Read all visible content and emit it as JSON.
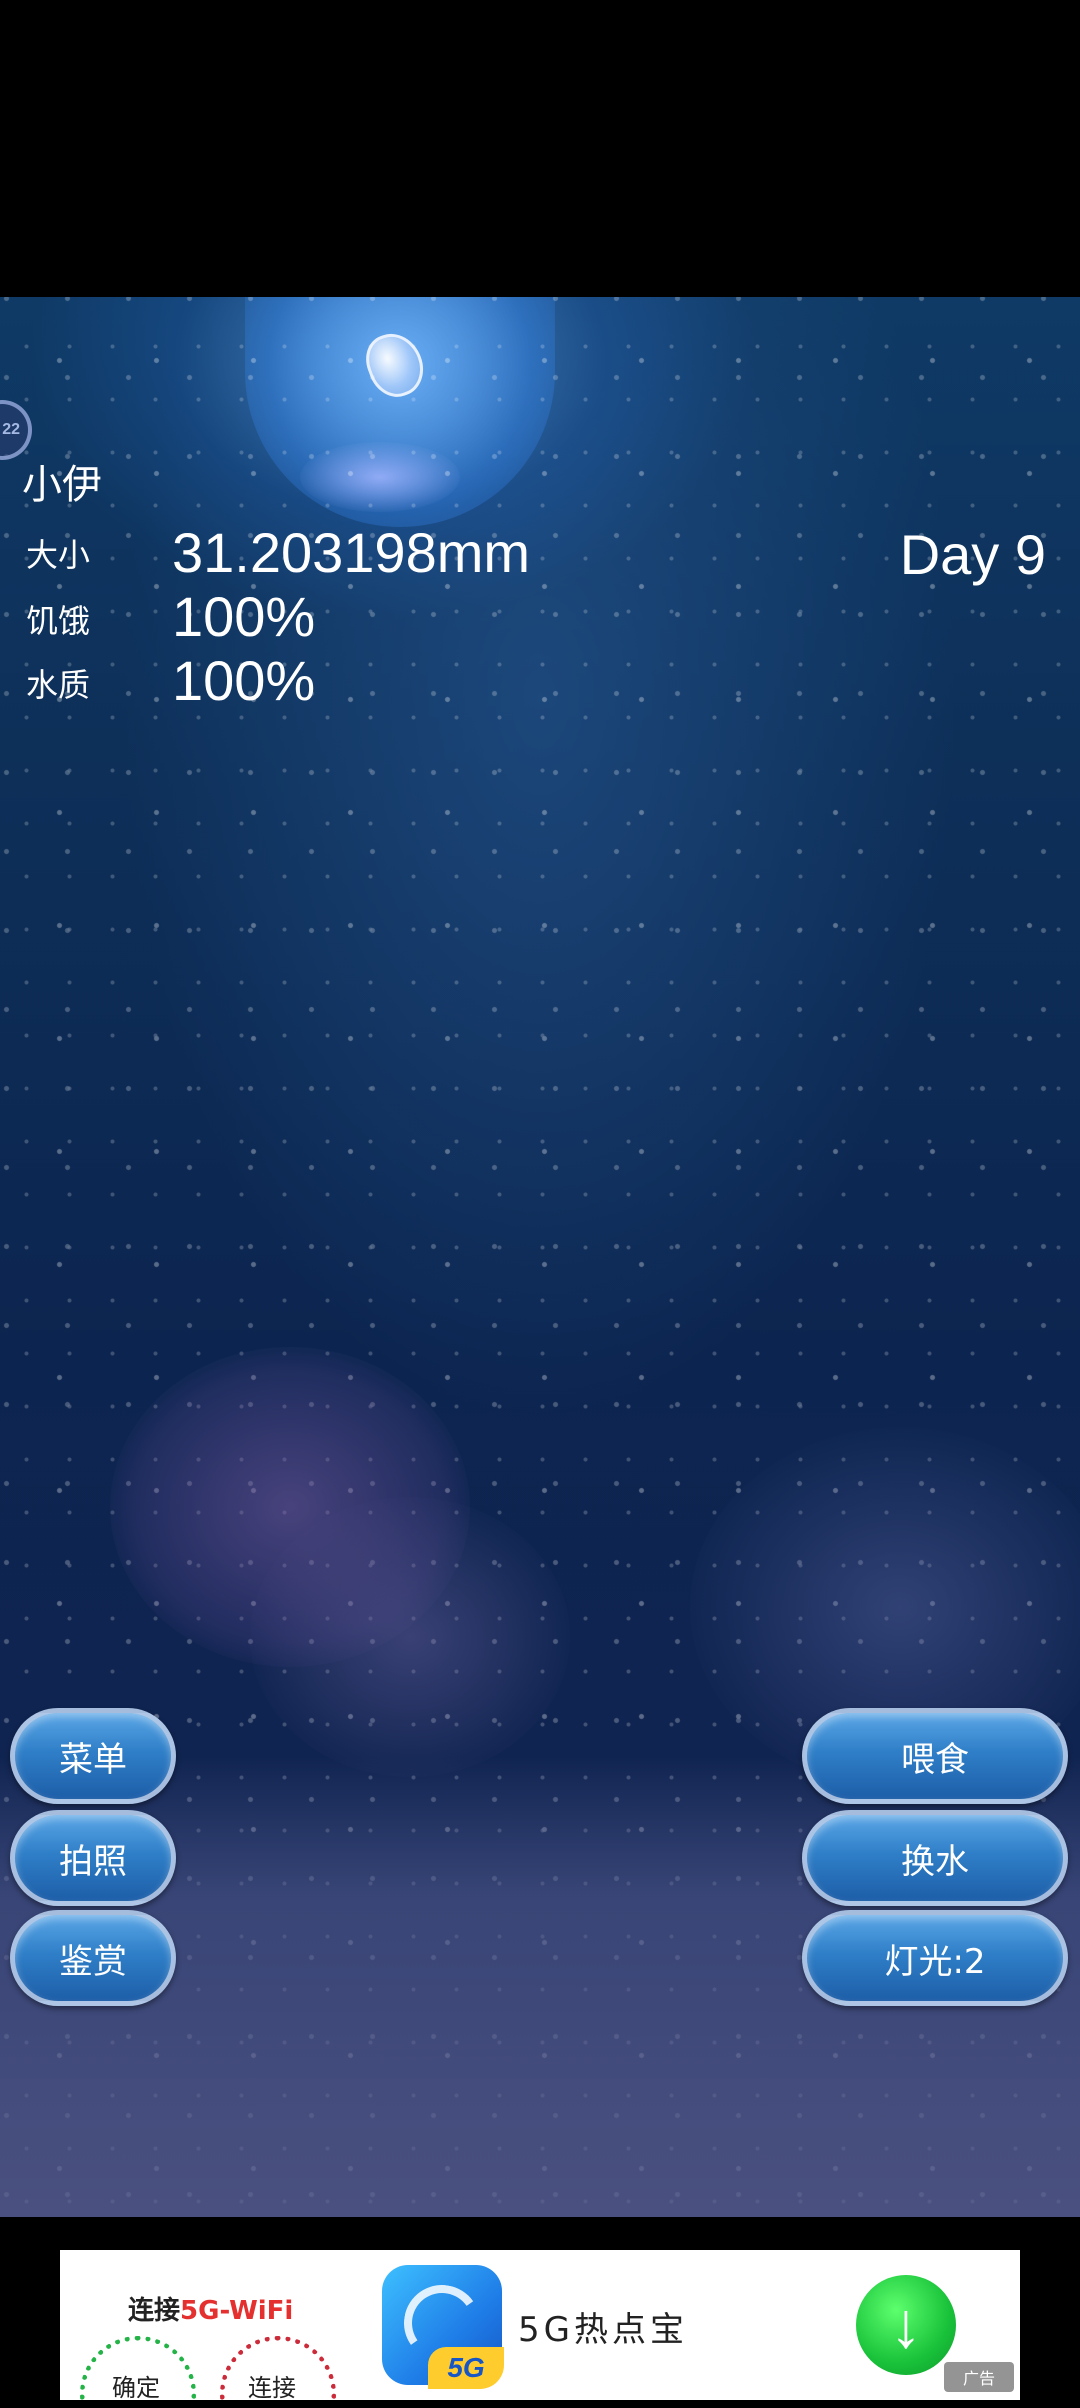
{
  "pet": {
    "name": "小伊",
    "size_label": "大小",
    "size_value": "31.203198mm",
    "hunger_label": "饥饿",
    "hunger_value": "100%",
    "water_label": "水质",
    "water_value": "100%",
    "day": "Day 9"
  },
  "side_tab": {
    "text": "22"
  },
  "buttons": {
    "left": [
      "菜单",
      "拍照",
      "鉴赏"
    ],
    "right": [
      "喂食",
      "换水",
      "灯光:2"
    ]
  },
  "ad": {
    "wifi_title_prefix": "连接",
    "wifi_title_highlight": "5G-WiFi",
    "confirm": "确定",
    "connect": "连接",
    "app_icon_tag": "5G",
    "app_name": "5G热点宝",
    "download_icon": "download-arrow-icon",
    "ad_badge": "广告",
    "colors": {
      "green": "#19c23a",
      "red": "#e53030",
      "yellow": "#ffcc2e",
      "blue": "#1f7ee8"
    }
  }
}
